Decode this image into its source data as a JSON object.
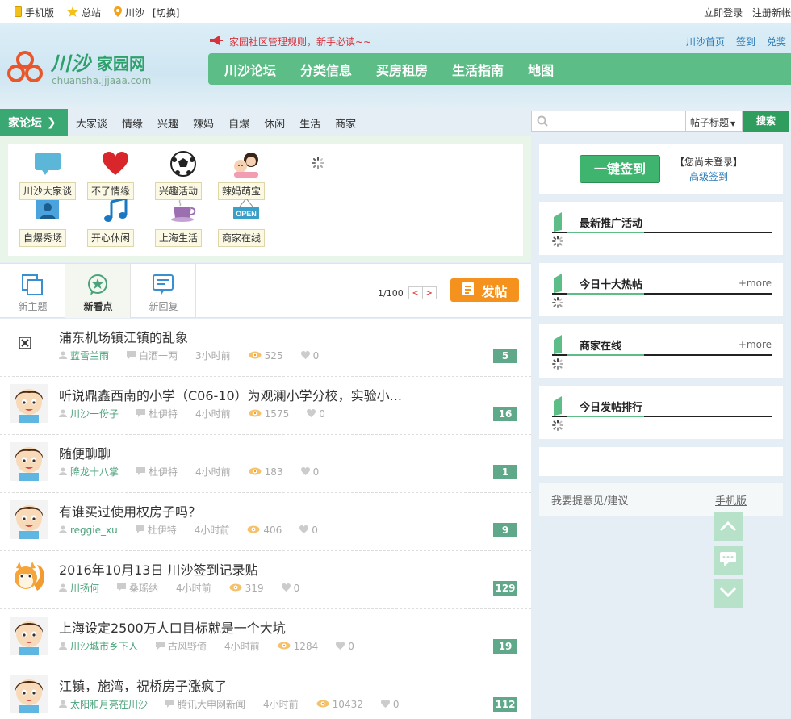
{
  "topbar": {
    "mobile": "手机版",
    "main_site": "总站",
    "city": "川沙",
    "switch": "[切换]",
    "login": "立即登录",
    "register": "注册新帐"
  },
  "header": {
    "logo_text": "川沙",
    "logo_suffix": "家园网",
    "logo_domain": "chuansha.jjjaaa.com",
    "notice": "家园社区管理规则，新手必读~~",
    "quicklinks": [
      "川沙首页",
      "签到",
      "兑奖"
    ],
    "nav": [
      "川沙论坛",
      "分类信息",
      "买房租房",
      "生活指南",
      "地图"
    ]
  },
  "subnav": {
    "tag": "家论坛",
    "items": [
      "大家谈",
      "情缘",
      "兴趣",
      "辣妈",
      "自爆",
      "休闲",
      "生活",
      "商家"
    ]
  },
  "search": {
    "placeholder": "",
    "scope": "帖子标题",
    "button": "搜索"
  },
  "categories": [
    {
      "label": "川沙大家谈",
      "icon": "chat-bubble-icon"
    },
    {
      "label": "不了情缘",
      "icon": "heart-icon"
    },
    {
      "label": "兴趣活动",
      "icon": "soccer-ball-icon"
    },
    {
      "label": "辣妈萌宝",
      "icon": "mom-baby-icon"
    },
    {
      "label": "自爆秀场",
      "icon": "profile-photo-icon"
    },
    {
      "label": "开心休闲",
      "icon": "music-note-icon"
    },
    {
      "label": "上海生活",
      "icon": "coffee-cup-icon"
    },
    {
      "label": "商家在线",
      "icon": "open-sign-icon"
    }
  ],
  "tabs": [
    {
      "label": "新主题",
      "icon": "new-topic-icon"
    },
    {
      "label": "新看点",
      "icon": "star-bubble-icon",
      "active": true
    },
    {
      "label": "新回复",
      "icon": "reply-icon"
    }
  ],
  "pager": {
    "text": "1/100",
    "prev": "<",
    "next": ">"
  },
  "post_button": "发帖",
  "posts": [
    {
      "title": "浦东机场镇江镇的乱象",
      "author": "蓝雪兰雨",
      "last": "白酒一两",
      "time": "3小时前",
      "views": "525",
      "likes": "0",
      "replies": "5",
      "avatar": "broken-image"
    },
    {
      "title": "听说鼎鑫西南的小学（C06-10）为观澜小学分校，实验小...",
      "author": "川沙一份子",
      "last": "杜伊特",
      "time": "4小时前",
      "views": "1575",
      "likes": "0",
      "replies": "16",
      "avatar": "cartoon-boy"
    },
    {
      "title": "随便聊聊",
      "author": "降龙十八掌",
      "last": "杜伊特",
      "time": "4小时前",
      "views": "183",
      "likes": "0",
      "replies": "1",
      "avatar": "cartoon-boy"
    },
    {
      "title": "有谁买过使用权房子吗？",
      "author": "reggie_xu",
      "last": "杜伊特",
      "time": "4小时前",
      "views": "406",
      "likes": "0",
      "replies": "9",
      "avatar": "cartoon-boy"
    },
    {
      "title": "2016年10月13日  川沙签到记录贴",
      "author": "川扬何",
      "last": "桑瑶纳",
      "time": "4小时前",
      "views": "319",
      "likes": "0",
      "replies": "129",
      "avatar": "squirrel"
    },
    {
      "title": "上海设定2500万人口目标就是一个大坑",
      "author": "川沙城市乡下人",
      "last": "古风野倚",
      "time": "4小时前",
      "views": "1284",
      "likes": "0",
      "replies": "19",
      "avatar": "cartoon-boy"
    },
    {
      "title": "江镇，施湾，祝桥房子涨疯了",
      "author": "太阳和月亮在川沙",
      "last": "腾讯大申网新闻",
      "time": "4小时前",
      "views": "10432",
      "likes": "0",
      "replies": "112",
      "avatar": "cartoon-boy"
    }
  ],
  "sidebar": {
    "sign_button": "一键签到",
    "sign_status": "【您尚未登录】",
    "sign_link": "高级签到",
    "boxes": [
      {
        "title": "最新推广活动",
        "more": ""
      },
      {
        "title": "今日十大热帖",
        "more": "+more"
      },
      {
        "title": "商家在线",
        "more": "+more"
      },
      {
        "title": "今日发帖排行",
        "more": ""
      }
    ],
    "feedback": "我要提意见/建议",
    "mobile": "手机版"
  },
  "colors": {
    "brand_green": "#5cbd87",
    "accent_orange": "#f5921e",
    "link_blue": "#2b7bb9",
    "notice_red": "#d8323c"
  }
}
